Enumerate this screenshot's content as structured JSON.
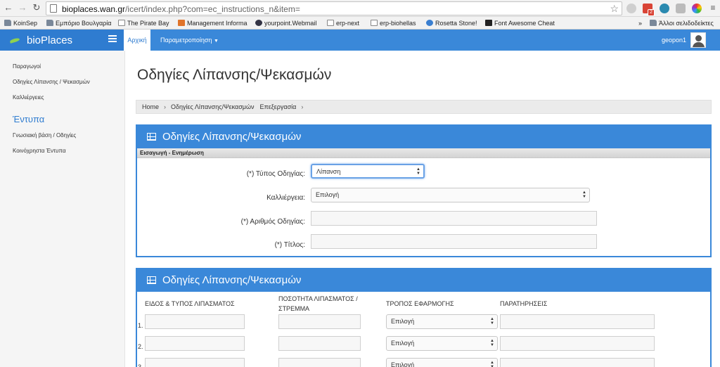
{
  "browser": {
    "url_host": "bioplaces.wan.gr",
    "url_path": "/icert/index.php?com=ec_instructions_n&item=",
    "mail_badge": "2",
    "bookmarks": [
      {
        "label": "KoinSep",
        "icon": "folder"
      },
      {
        "label": "Εμπόριο Βουλγαρία",
        "icon": "folder"
      },
      {
        "label": "The Pirate Bay",
        "icon": "page"
      },
      {
        "label": "Management Informa",
        "icon": "page"
      },
      {
        "label": "yourpoint.Webmail",
        "icon": "page"
      },
      {
        "label": "erp-next",
        "icon": "page"
      },
      {
        "label": "erp-biohellas",
        "icon": "page"
      },
      {
        "label": "Rosetta Stone!",
        "icon": "page"
      },
      {
        "label": "Font Awesome Cheat",
        "icon": "page"
      }
    ],
    "other_bookmarks": "Άλλοι σελιδοδείκτες",
    "overflow": "»"
  },
  "app": {
    "brand": "bioPlaces",
    "nav_home": "Αρχική",
    "nav_params": "Παραμετροποίηση",
    "user": "geopon1"
  },
  "sidebar": {
    "items_top": [
      "Παραγωγοί",
      "Οδηγίες Λίπανσης / Ψεκασμών",
      "Καλλιέργειες"
    ],
    "heading": "Έντυπα",
    "items_bottom": [
      "Γνωσιακή βάση / Οδηγίες",
      "Κοινόχρηστα Έντυπα"
    ]
  },
  "main": {
    "title": "Οδηγίες Λίπανσης/Ψεκασμών",
    "breadcrumb": [
      "Home",
      "Οδηγίες Λίπανσης/Ψεκασμών",
      "Επεξεργασία"
    ],
    "panel1": {
      "title": "Οδηγίες Λίπανσης/Ψεκασμών",
      "subheader": "Εισαγωγή - Ενημέρωση",
      "type_label": "(*) Τύπος Οδηγίας:",
      "type_value": "Λίπανση",
      "crop_label": "Καλλιέργεια:",
      "crop_value": "Επιλογή",
      "number_label": "(*) Αριθμός Οδηγίας:",
      "number_value": "",
      "title_label": "(*) Τίτλος:",
      "title_value": ""
    },
    "panel2": {
      "title": "Οδηγίες Λίπανσης/Ψεκασμών",
      "col_type": "ΕΙΔΟΣ & ΤΥΠΟΣ ΛΙΠΑΣΜΑΤΟΣ",
      "col_qty_1": "ΠΟΣΟΤΗΤΑ ΛΙΠΑΣΜΑΤΟΣ /",
      "col_qty_2": "ΣΤΡΕΜΜΑ",
      "col_method": "ΤΡΟΠΟΣ ΕΦΑΡΜΟΓΗΣ",
      "col_notes": "ΠΑΡΑΤΗΡΗΣΕΙΣ",
      "rows": [
        {
          "num": "1.",
          "method": "Επιλογή"
        },
        {
          "num": "2.",
          "method": "Επιλογή"
        },
        {
          "num": "3.",
          "method": "Επιλογή"
        }
      ]
    }
  }
}
